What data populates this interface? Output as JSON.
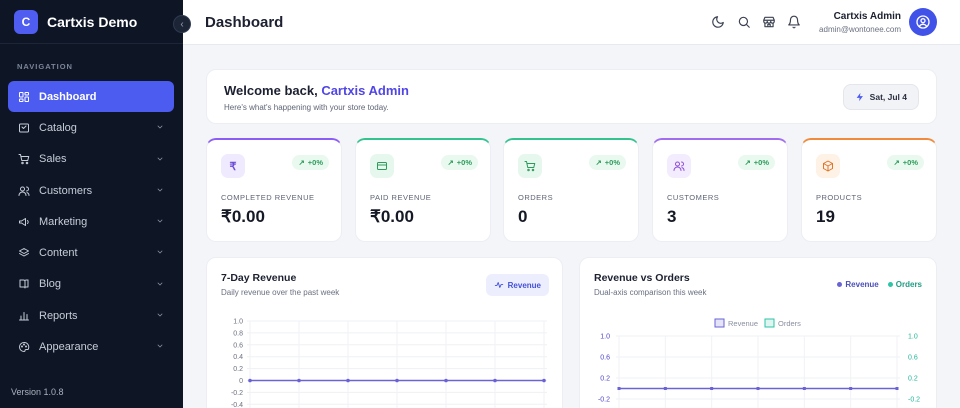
{
  "app": {
    "brand_initial": "C",
    "brand_name": "Cartxis Demo",
    "version": "Version 1.0.8"
  },
  "sidebar": {
    "heading": "NAVIGATION",
    "items": [
      {
        "label": "Dashboard",
        "icon": "dashboard-icon",
        "active": true
      },
      {
        "label": "Catalog",
        "icon": "catalog-icon"
      },
      {
        "label": "Sales",
        "icon": "cart-icon"
      },
      {
        "label": "Customers",
        "icon": "users-icon"
      },
      {
        "label": "Marketing",
        "icon": "megaphone-icon"
      },
      {
        "label": "Content",
        "icon": "layers-icon"
      },
      {
        "label": "Blog",
        "icon": "book-icon"
      },
      {
        "label": "Reports",
        "icon": "bar-chart-icon"
      },
      {
        "label": "Appearance",
        "icon": "palette-icon"
      }
    ]
  },
  "header": {
    "title": "Dashboard",
    "user_name": "Cartxis Admin",
    "user_email": "admin@wontonee.com"
  },
  "welcome": {
    "prefix": "Welcome back, ",
    "name": "Cartxis Admin",
    "subtitle": "Here's what's happening with your store today.",
    "date": "Sat, Jul 4"
  },
  "stats": [
    {
      "label": "COMPLETED REVENUE",
      "value": "₹0.00",
      "change": "+0%",
      "icon": "rupee-icon",
      "accent": "#8b5cf6",
      "icon_bg": "#efeafe",
      "icon_color": "#6d4cd6"
    },
    {
      "label": "PAID REVENUE",
      "value": "₹0.00",
      "change": "+0%",
      "icon": "credit-card-icon",
      "accent": "#34c38f",
      "icon_bg": "#e6f7ee",
      "icon_color": "#2d9b5a"
    },
    {
      "label": "ORDERS",
      "value": "0",
      "change": "+0%",
      "icon": "cart-icon",
      "accent": "#34c38f",
      "icon_bg": "#e6f7ee",
      "icon_color": "#2d9b5a"
    },
    {
      "label": "CUSTOMERS",
      "value": "3",
      "change": "+0%",
      "icon": "users-icon",
      "accent": "#a06cf0",
      "icon_bg": "#f3ecfe",
      "icon_color": "#8d4fd8"
    },
    {
      "label": "PRODUCTS",
      "value": "19",
      "change": "+0%",
      "icon": "box-icon",
      "accent": "#f08a3c",
      "icon_bg": "#fef1e6",
      "icon_color": "#e0742a"
    }
  ],
  "charts": {
    "revenue": {
      "title": "7-Day Revenue",
      "subtitle": "Daily revenue over the past week",
      "button": "Revenue"
    },
    "rev_orders": {
      "title": "Revenue vs Orders",
      "subtitle": "Dual-axis comparison this week",
      "legend_revenue": "Revenue",
      "legend_orders": "Orders",
      "inner_legend_revenue": "Revenue",
      "inner_legend_orders": "Orders"
    }
  },
  "chart_data": [
    {
      "type": "line",
      "title": "7-Day Revenue",
      "series": [
        {
          "name": "Revenue",
          "values": [
            0,
            0,
            0,
            0,
            0,
            0,
            0
          ]
        }
      ],
      "y_ticks": [
        "1.0",
        "0.8",
        "0.6",
        "0.4",
        "0.2",
        "0",
        "-0.2",
        "-0.4"
      ],
      "ylim": [
        -0.4,
        1.0
      ],
      "color": "#6a63d6"
    },
    {
      "type": "line",
      "title": "Revenue vs Orders",
      "series": [
        {
          "name": "Revenue",
          "values": [
            0,
            0,
            0,
            0,
            0,
            0,
            0
          ]
        },
        {
          "name": "Orders",
          "values": [
            0,
            0,
            0,
            0,
            0,
            0,
            0
          ]
        }
      ],
      "y_ticks_left": [
        "1.0",
        "0.6",
        "0.2",
        "-0.2"
      ],
      "y_ticks_right": [
        "1.0",
        "0.6",
        "0.2",
        "-0.2"
      ],
      "colors": {
        "revenue": "#6a63d6",
        "orders": "#2ec4a6"
      }
    }
  ]
}
